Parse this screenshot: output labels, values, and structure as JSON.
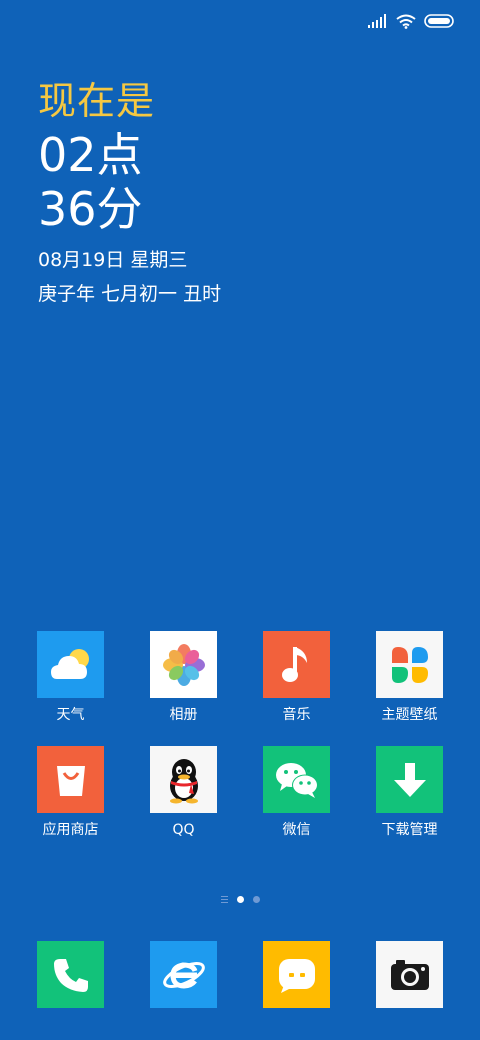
{
  "clock": {
    "label": "现在是",
    "hour": "02点",
    "minute": "36分",
    "date": "08月19日  星期三",
    "lunar": "庚子年  七月初一  丑时"
  },
  "apps": [
    {
      "label": "天气",
      "icon": "weather-icon",
      "color": "#1e9bef"
    },
    {
      "label": "相册",
      "icon": "gallery-icon",
      "color": "#ffffff"
    },
    {
      "label": "音乐",
      "icon": "music-icon",
      "color": "#f2613c"
    },
    {
      "label": "主题壁纸",
      "icon": "themes-icon",
      "color": "#f7f7f7"
    },
    {
      "label": "应用商店",
      "icon": "app-store-icon",
      "color": "#f2613c"
    },
    {
      "label": "QQ",
      "icon": "qq-icon",
      "color": "#f7f7f7"
    },
    {
      "label": "微信",
      "icon": "wechat-icon",
      "color": "#12c27a"
    },
    {
      "label": "下载管理",
      "icon": "download-icon",
      "color": "#12c27a"
    }
  ],
  "dock": [
    {
      "icon": "phone-icon",
      "color": "#12c27a"
    },
    {
      "icon": "browser-icon",
      "color": "#1e9bef"
    },
    {
      "icon": "messages-icon",
      "color": "#ffbb00"
    },
    {
      "icon": "camera-icon",
      "color": "#f7f7f7"
    }
  ],
  "pages": {
    "count": 2,
    "current": 1
  },
  "colors": {
    "wallpaper": "#0f62b8",
    "accent": "#f5c842"
  }
}
